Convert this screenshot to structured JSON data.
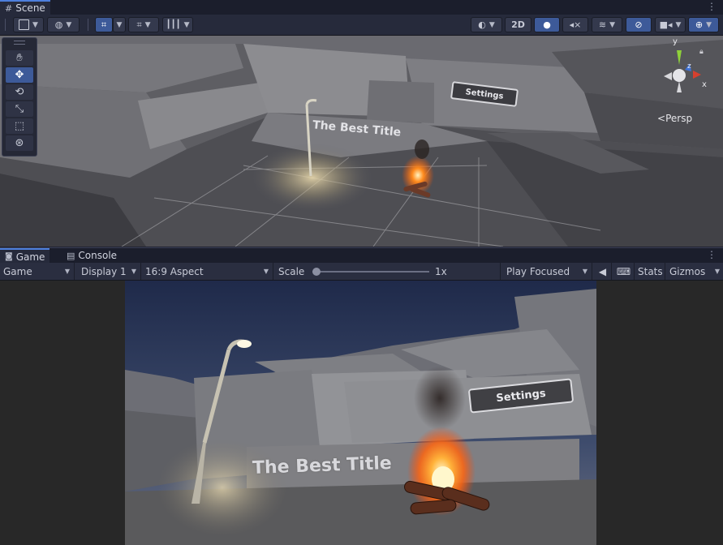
{
  "scene_tab": {
    "label": "Scene"
  },
  "scene_toolbar": {
    "mode_2d": "2D"
  },
  "scene_view": {
    "camera_label": "Persp",
    "gizmo_axes": {
      "x": "x",
      "y": "y",
      "z": "z"
    },
    "sign_title": "The Best Title",
    "sign_settings": "Settings"
  },
  "tools": [
    {
      "name": "hand-tool",
      "icon": "hand-icon"
    },
    {
      "name": "move-tool",
      "icon": "move-icon",
      "active": true
    },
    {
      "name": "rotate-tool",
      "icon": "rotate-icon"
    },
    {
      "name": "scale-tool",
      "icon": "scale-icon"
    },
    {
      "name": "rect-tool",
      "icon": "rect-icon"
    },
    {
      "name": "transform-tool",
      "icon": "transform-icon"
    }
  ],
  "bottom_tabs": {
    "game": "Game",
    "console": "Console"
  },
  "game_toolbar": {
    "view_select": "Game",
    "display_select": "Display 1",
    "aspect_select": "16:9 Aspect",
    "scale_label": "Scale",
    "scale_value_text": "1x",
    "scale_value": 0.0,
    "play_mode_select": "Play Focused",
    "stats_label": "Stats",
    "gizmos_label": "Gizmos"
  },
  "game_view": {
    "sign_title": "The Best Title",
    "sign_settings": "Settings"
  },
  "colors": {
    "accent_blue": "#3d5a99",
    "tab_highlight": "#4d7fdd",
    "gizmo_x": "#d6402f",
    "gizmo_y": "#8fd13a",
    "gizmo_z": "#3f72d6",
    "fire": "#ff8a1c"
  }
}
